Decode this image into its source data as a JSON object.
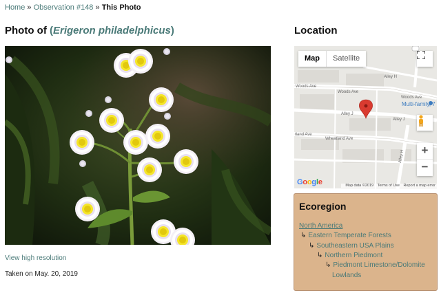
{
  "breadcrumb": {
    "home": "Home",
    "sep1": "»",
    "observation": "Observation #148",
    "sep2": "»",
    "current": "This Photo"
  },
  "photo": {
    "title_prefix": "Photo of",
    "paren_open": "(",
    "taxon": "Erigeron philadelphicus",
    "paren_close": ")",
    "hires_link": "View high resolution",
    "taken_on": "Taken on May. 20, 2019"
  },
  "location": {
    "title": "Location",
    "map": {
      "tabs": [
        "Map",
        "Satellite"
      ],
      "active_tab": "Map",
      "zoom_in": "+",
      "zoom_out": "−",
      "place_label": "Multi-family, 7",
      "street_labels": [
        "Woods Ave",
        "Woods Ave",
        "Woods Ave",
        "Alley H",
        "Alley J",
        "Alley J",
        "Wheatland Ave",
        "tland Ave",
        "Alley H"
      ],
      "google_logo": "Google",
      "footer": [
        "Map data ©2019",
        "Terms of Use",
        "Report a map error"
      ]
    }
  },
  "ecoregion": {
    "title": "Ecoregion",
    "arrow": "↳",
    "levels": [
      "North America",
      "Eastern Temperate Forests",
      "Southeastern USA Plains",
      "Northern Piedmont",
      "Piedmont Limestone/Dolomite",
      "Lowlands"
    ]
  },
  "colors": {
    "link": "#4a7a78",
    "ecoregion_bg": "#dbb48c",
    "map_bg": "#e9e8e4",
    "pin": "#d93b30"
  }
}
